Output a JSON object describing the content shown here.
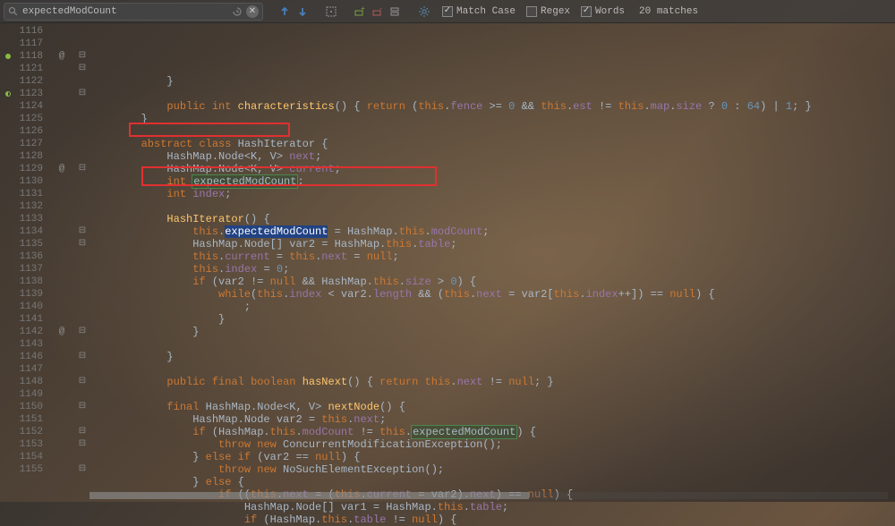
{
  "search": {
    "query": "expectedModCount",
    "matches_label": "20 matches"
  },
  "options": {
    "match_case_label": "Match Case",
    "match_case_checked": true,
    "regex_label": "Regex",
    "regex_checked": false,
    "words_label": "Words",
    "words_checked": true
  },
  "first_line_number": 1116,
  "code_lines": [
    {
      "n": 1116,
      "indent": 12,
      "tokens": [
        "}"
      ]
    },
    {
      "n": 1117,
      "indent": 0,
      "tokens": []
    },
    {
      "n": 1118,
      "indent": 12,
      "marker": "circle",
      "at": true,
      "fold": "-",
      "tokens": [
        {
          "t": "public",
          "c": "kw"
        },
        " ",
        {
          "t": "int",
          "c": "kw"
        },
        " ",
        {
          "t": "characteristics",
          "c": "mth"
        },
        "() { ",
        {
          "t": "return",
          "c": "kw"
        },
        " (",
        {
          "t": "this",
          "c": "kw"
        },
        ".",
        {
          "t": "fence",
          "c": "fld"
        },
        " >= ",
        {
          "t": "0",
          "c": "num"
        },
        " && ",
        {
          "t": "this",
          "c": "kw"
        },
        ".",
        {
          "t": "est",
          "c": "fld"
        },
        " != ",
        {
          "t": "this",
          "c": "kw"
        },
        ".",
        {
          "t": "map",
          "c": "fld"
        },
        ".",
        {
          "t": "size",
          "c": "fld"
        },
        " ? ",
        {
          "t": "0",
          "c": "num"
        },
        " : ",
        {
          "t": "64",
          "c": "num"
        },
        ") | ",
        {
          "t": "1",
          "c": "num"
        },
        "; }"
      ]
    },
    {
      "n": 1121,
      "indent": 8,
      "fold": "-",
      "tokens": [
        "}"
      ]
    },
    {
      "n": 1122,
      "indent": 0,
      "tokens": []
    },
    {
      "n": 1123,
      "indent": 8,
      "marker": "half",
      "fold": "-",
      "tokens": [
        {
          "t": "abstract",
          "c": "kw"
        },
        " ",
        {
          "t": "class",
          "c": "kw"
        },
        " ",
        {
          "t": "HashIterator",
          "c": "typ"
        },
        " {"
      ]
    },
    {
      "n": 1124,
      "indent": 12,
      "tokens": [
        "HashMap.Node<",
        {
          "t": "K",
          "c": "typ"
        },
        ", ",
        {
          "t": "V",
          "c": "typ"
        },
        "> ",
        {
          "t": "next",
          "c": "fld"
        },
        ";"
      ]
    },
    {
      "n": 1125,
      "indent": 12,
      "tokens": [
        "HashMap.Node<",
        {
          "t": "K",
          "c": "typ"
        },
        ", ",
        {
          "t": "V",
          "c": "typ"
        },
        "> ",
        {
          "t": "current",
          "c": "fld"
        },
        ";"
      ]
    },
    {
      "n": 1126,
      "indent": 12,
      "tokens": [
        {
          "t": "int",
          "c": "kw"
        },
        " ",
        {
          "t": "expectedModCount",
          "c": "hl"
        },
        ";"
      ]
    },
    {
      "n": 1127,
      "indent": 12,
      "tokens": [
        {
          "t": "int",
          "c": "kw"
        },
        " ",
        {
          "t": "index",
          "c": "fld"
        },
        ";"
      ]
    },
    {
      "n": 1128,
      "indent": 0,
      "tokens": []
    },
    {
      "n": 1129,
      "indent": 12,
      "at": true,
      "fold": "-",
      "tokens": [
        {
          "t": "HashIterator",
          "c": "mth"
        },
        "() {"
      ]
    },
    {
      "n": 1130,
      "indent": 16,
      "tokens": [
        {
          "t": "this",
          "c": "kw"
        },
        ".",
        {
          "t": "expectedModCount",
          "c": "sel-hl"
        },
        " = HashMap.",
        {
          "t": "this",
          "c": "kw"
        },
        ".",
        {
          "t": "modCount",
          "c": "fld"
        },
        ";"
      ]
    },
    {
      "n": 1131,
      "indent": 16,
      "tokens": [
        "HashMap.Node[] var2 = HashMap.",
        {
          "t": "this",
          "c": "kw"
        },
        ".",
        {
          "t": "table",
          "c": "fld"
        },
        ";"
      ]
    },
    {
      "n": 1132,
      "indent": 16,
      "tokens": [
        {
          "t": "this",
          "c": "kw"
        },
        ".",
        {
          "t": "current",
          "c": "fld"
        },
        " = ",
        {
          "t": "this",
          "c": "kw"
        },
        ".",
        {
          "t": "next",
          "c": "fld"
        },
        " = ",
        {
          "t": "null",
          "c": "kw"
        },
        ";"
      ]
    },
    {
      "n": 1133,
      "indent": 16,
      "tokens": [
        {
          "t": "this",
          "c": "kw"
        },
        ".",
        {
          "t": "index",
          "c": "fld"
        },
        " = ",
        {
          "t": "0",
          "c": "num"
        },
        ";"
      ]
    },
    {
      "n": 1134,
      "indent": 16,
      "fold": "-",
      "tokens": [
        {
          "t": "if",
          "c": "kw"
        },
        " (var2 != ",
        {
          "t": "null",
          "c": "kw"
        },
        " && HashMap.",
        {
          "t": "this",
          "c": "kw"
        },
        ".",
        {
          "t": "size",
          "c": "fld"
        },
        " > ",
        {
          "t": "0",
          "c": "num"
        },
        ") {"
      ]
    },
    {
      "n": 1135,
      "indent": 20,
      "fold": "-",
      "tokens": [
        {
          "t": "while",
          "c": "kw"
        },
        "(",
        {
          "t": "this",
          "c": "kw"
        },
        ".",
        {
          "t": "index",
          "c": "fld"
        },
        " < var2.",
        {
          "t": "length",
          "c": "fld"
        },
        " && (",
        {
          "t": "this",
          "c": "kw"
        },
        ".",
        {
          "t": "next",
          "c": "fld"
        },
        " = var2[",
        {
          "t": "this",
          "c": "kw"
        },
        ".",
        {
          "t": "index",
          "c": "fld"
        },
        "++]) == ",
        {
          "t": "null",
          "c": "kw"
        },
        ") {"
      ]
    },
    {
      "n": 1136,
      "indent": 24,
      "tokens": [
        ";"
      ]
    },
    {
      "n": 1137,
      "indent": 20,
      "tokens": [
        "}"
      ]
    },
    {
      "n": 1138,
      "indent": 16,
      "tokens": [
        "}"
      ]
    },
    {
      "n": 1139,
      "indent": 0,
      "tokens": []
    },
    {
      "n": 1140,
      "indent": 12,
      "tokens": [
        "}"
      ]
    },
    {
      "n": 1141,
      "indent": 0,
      "tokens": []
    },
    {
      "n": 1142,
      "indent": 12,
      "at": true,
      "fold": "-",
      "tokens": [
        {
          "t": "public",
          "c": "kw"
        },
        " ",
        {
          "t": "final",
          "c": "kw"
        },
        " ",
        {
          "t": "boolean",
          "c": "kw"
        },
        " ",
        {
          "t": "hasNext",
          "c": "mth"
        },
        "() { ",
        {
          "t": "return",
          "c": "kw"
        },
        " ",
        {
          "t": "this",
          "c": "kw"
        },
        ".",
        {
          "t": "next",
          "c": "fld"
        },
        " != ",
        {
          "t": "null",
          "c": "kw"
        },
        "; }"
      ]
    },
    {
      "n": 1143,
      "indent": 0,
      "tokens": []
    },
    {
      "n": 1146,
      "indent": 12,
      "fold": "-",
      "tokens": [
        {
          "t": "final",
          "c": "kw"
        },
        " HashMap.Node<",
        {
          "t": "K",
          "c": "typ"
        },
        ", ",
        {
          "t": "V",
          "c": "typ"
        },
        "> ",
        {
          "t": "nextNode",
          "c": "mth"
        },
        "() {"
      ]
    },
    {
      "n": 1147,
      "indent": 16,
      "tokens": [
        "HashMap.Node var2 = ",
        {
          "t": "this",
          "c": "kw"
        },
        ".",
        {
          "t": "next",
          "c": "fld"
        },
        ";"
      ]
    },
    {
      "n": 1148,
      "indent": 16,
      "fold": "-",
      "tokens": [
        {
          "t": "if",
          "c": "kw"
        },
        " (HashMap.",
        {
          "t": "this",
          "c": "kw"
        },
        ".",
        {
          "t": "modCount",
          "c": "fld"
        },
        " != ",
        {
          "t": "this",
          "c": "kw"
        },
        ".",
        {
          "t": "expectedModCount",
          "c": "hl"
        },
        ") {"
      ]
    },
    {
      "n": 1149,
      "indent": 20,
      "tokens": [
        {
          "t": "throw",
          "c": "kw"
        },
        " ",
        {
          "t": "new",
          "c": "kw"
        },
        " ConcurrentModificationException();"
      ]
    },
    {
      "n": 1150,
      "indent": 16,
      "fold": "-",
      "tokens": [
        "} ",
        {
          "t": "else",
          "c": "kw"
        },
        " ",
        {
          "t": "if",
          "c": "kw"
        },
        " (var2 == ",
        {
          "t": "null",
          "c": "kw"
        },
        ") {"
      ]
    },
    {
      "n": 1151,
      "indent": 20,
      "tokens": [
        {
          "t": "throw",
          "c": "kw"
        },
        " ",
        {
          "t": "new",
          "c": "kw"
        },
        " NoSuchElementException();"
      ]
    },
    {
      "n": 1152,
      "indent": 16,
      "fold": "-",
      "tokens": [
        "} ",
        {
          "t": "else",
          "c": "kw"
        },
        " {"
      ]
    },
    {
      "n": 1153,
      "indent": 20,
      "fold": "-",
      "tokens": [
        {
          "t": "if",
          "c": "kw"
        },
        " ((",
        {
          "t": "this",
          "c": "kw"
        },
        ".",
        {
          "t": "next",
          "c": "fld"
        },
        " = (",
        {
          "t": "this",
          "c": "kw"
        },
        ".",
        {
          "t": "current",
          "c": "fld"
        },
        " = var2).",
        {
          "t": "next",
          "c": "fld"
        },
        ") == ",
        {
          "t": "null",
          "c": "kw"
        },
        ") {"
      ]
    },
    {
      "n": 1154,
      "indent": 24,
      "tokens": [
        "HashMap.Node[] var1 = HashMap.",
        {
          "t": "this",
          "c": "kw"
        },
        ".",
        {
          "t": "table",
          "c": "fld"
        },
        ";"
      ]
    },
    {
      "n": 1155,
      "indent": 24,
      "fold": "-",
      "tokens": [
        {
          "t": "if",
          "c": "kw"
        },
        " (HashMap.",
        {
          "t": "this",
          "c": "kw"
        },
        ".",
        {
          "t": "table",
          "c": "fld"
        },
        " != ",
        {
          "t": "null",
          "c": "kw"
        },
        ") {"
      ]
    }
  ]
}
